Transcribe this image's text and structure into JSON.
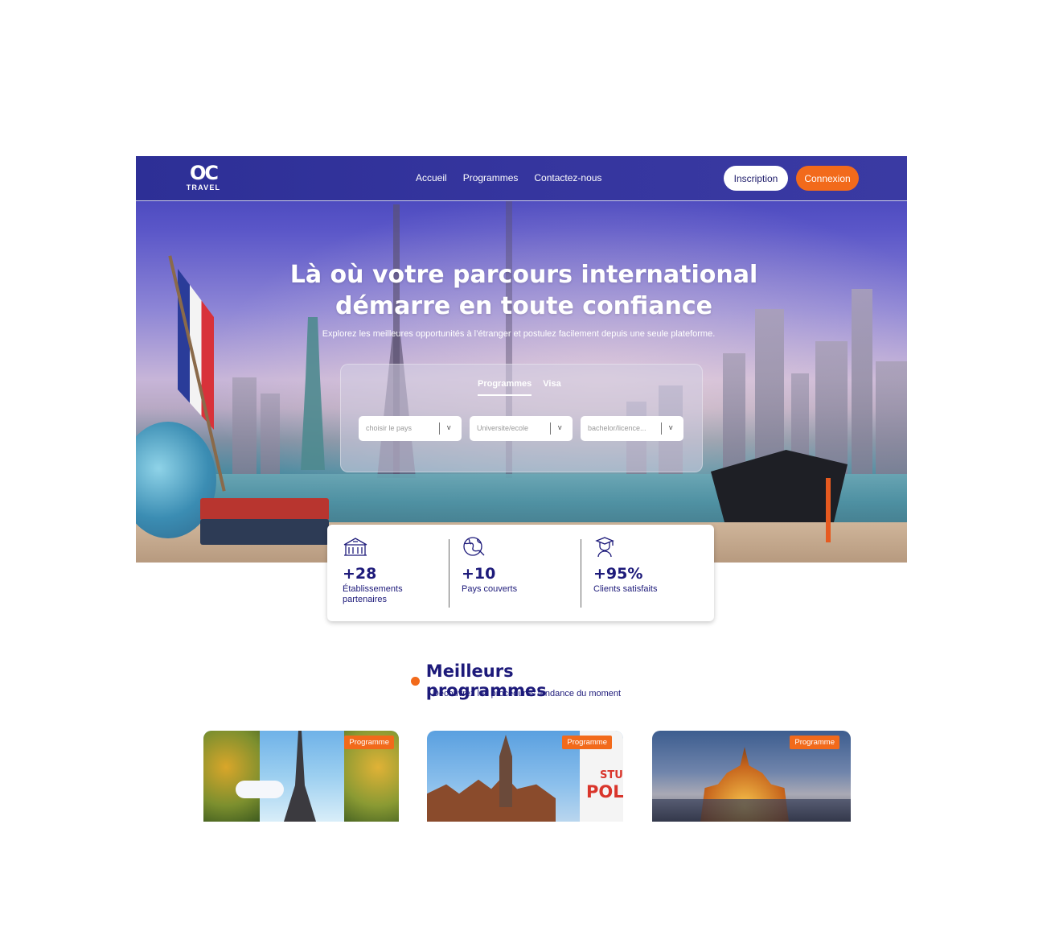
{
  "brand": {
    "logo_mark": "OC",
    "logo_word": "TRAVEL"
  },
  "nav": {
    "links": [
      "Accueil",
      "Programmes",
      "Contactez-nous"
    ],
    "signup": "Inscription",
    "login": "Connexion"
  },
  "hero": {
    "title_line1": "Là où votre parcours international",
    "title_line2": "démarre en toute confiance",
    "subtitle": "Explorez les meilleures opportunités à l’étranger et postulez facilement depuis une seule plateforme."
  },
  "search": {
    "tabs": [
      "Programmes",
      "Visa"
    ],
    "active_tab": "Programmes",
    "selects": [
      {
        "placeholder": "choisir le pays"
      },
      {
        "placeholder": "Universite/ecole"
      },
      {
        "placeholder": "bachelor/licence..."
      }
    ]
  },
  "stats": [
    {
      "icon": "building-icon",
      "value": "+28",
      "label": "Établissements partenaires"
    },
    {
      "icon": "globe-icon",
      "value": "+10",
      "label": "Pays couverts"
    },
    {
      "icon": "graduate-icon",
      "value": "+95%",
      "label": "Clients satisfaits"
    }
  ],
  "programs_section": {
    "title": "Meilleurs programmes",
    "subtitle": "Decouvrez les procédures tendance du moment",
    "cards": [
      {
        "badge": "Programme"
      },
      {
        "badge": "Programme",
        "image_text": [
          "STU",
          "POL"
        ]
      },
      {
        "badge": "Programme"
      }
    ]
  },
  "colors": {
    "navy": "#1d1a7a",
    "accent": "#f26a1b",
    "nav_bg": "#2d2f96"
  }
}
